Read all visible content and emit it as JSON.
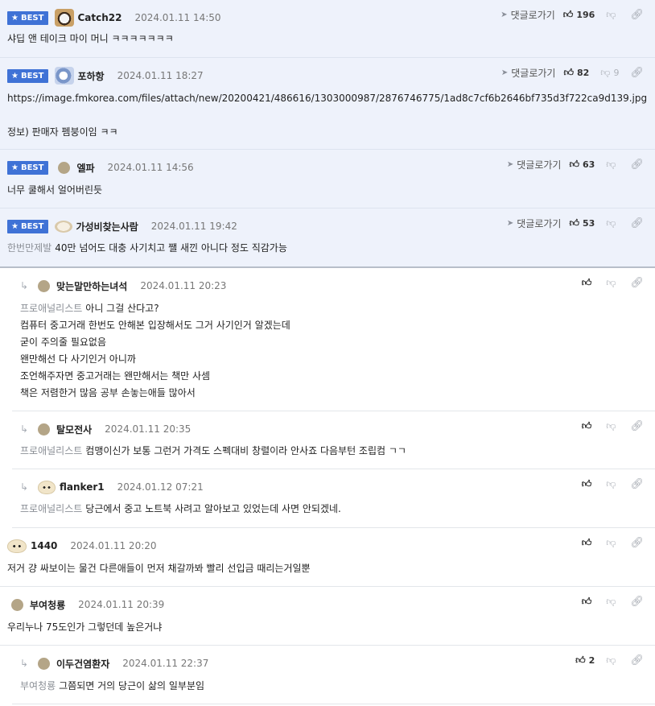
{
  "labels": {
    "best": "BEST",
    "reply_link": "댓글로가기"
  },
  "comments": [
    {
      "nick": "Catch22",
      "date": "2024.01.11 14:50",
      "up": "196",
      "down": "",
      "lines": [
        "샤딥 앤 테이크 마이 머니 ㅋㅋㅋㅋㅋㅋㅋ"
      ]
    },
    {
      "nick": "포하항",
      "date": "2024.01.11 18:27",
      "up": "82",
      "down": "9",
      "lines": [
        "https://image.fmkorea.com/files/attach/new/20200421/486616/1303000987/2876746775/1ad8c7cf6b2646bf735d3f722ca9d139.jpg",
        "",
        "정보) 판매자 펨붕이임 ㅋㅋ"
      ]
    },
    {
      "nick": "엘파",
      "date": "2024.01.11 14:56",
      "up": "63",
      "down": "",
      "lines": [
        "너무 쿨해서 얼어버린듯"
      ]
    },
    {
      "nick": "가성비찾는사람",
      "date": "2024.01.11 19:42",
      "up": "53",
      "down": "",
      "mention": "한번만제발",
      "lines": [
        "40만 넘어도 대충 사기치고 쨀 새낀 아니다 정도 직감가능"
      ]
    },
    {
      "nick": "맞는말만하는녀석",
      "date": "2024.01.11 20:23",
      "up": "",
      "down": "",
      "mention": "프로애널리스트",
      "lines": [
        "아니 그걸 산다고?",
        "컴퓨터 중고거래 한번도 안해본 입장해서도 그거 사기인거 알겠는데",
        "굳이 주의줄 필요없음",
        "왠만해선 다 사기인거 아니까",
        "조언해주자면 중고거래는 왠만해서는 책만 사셈",
        "책은 저렴한거 많음 공부 손놓는애들 많아서"
      ]
    },
    {
      "nick": "탈모전사",
      "date": "2024.01.11 20:35",
      "up": "",
      "down": "",
      "mention": "프로애널리스트",
      "lines": [
        "컴맹이신가 보통 그런거 가격도 스펙대비 창렬이라 안사죠 다음부턴 조립컴 ㄱㄱ"
      ]
    },
    {
      "nick": "flanker1",
      "date": "2024.01.12 07:21",
      "up": "",
      "down": "",
      "mention": "프로애널리스트",
      "lines": [
        "당근에서 중고 노트북 사려고 알아보고 있었는데 사면 안되겠네."
      ]
    },
    {
      "nick": "1440",
      "date": "2024.01.11 20:20",
      "up": "",
      "down": "",
      "lines": [
        "저거 걍 싸보이는 물건 다른애들이 먼저 채갈까봐 빨리 선입금 때리는거일뿐"
      ]
    },
    {
      "nick": "부여청룡",
      "date": "2024.01.11 20:39",
      "up": "",
      "down": "",
      "lines": [
        "우리누나 75도인가 그렇던데 높은거냐"
      ]
    },
    {
      "nick": "이두건염환자",
      "date": "2024.01.11 22:37",
      "up": "2",
      "down": "",
      "mention": "부여청룡",
      "lines": [
        "그쯤되면 거의 당근이 삶의 일부분임"
      ]
    }
  ]
}
